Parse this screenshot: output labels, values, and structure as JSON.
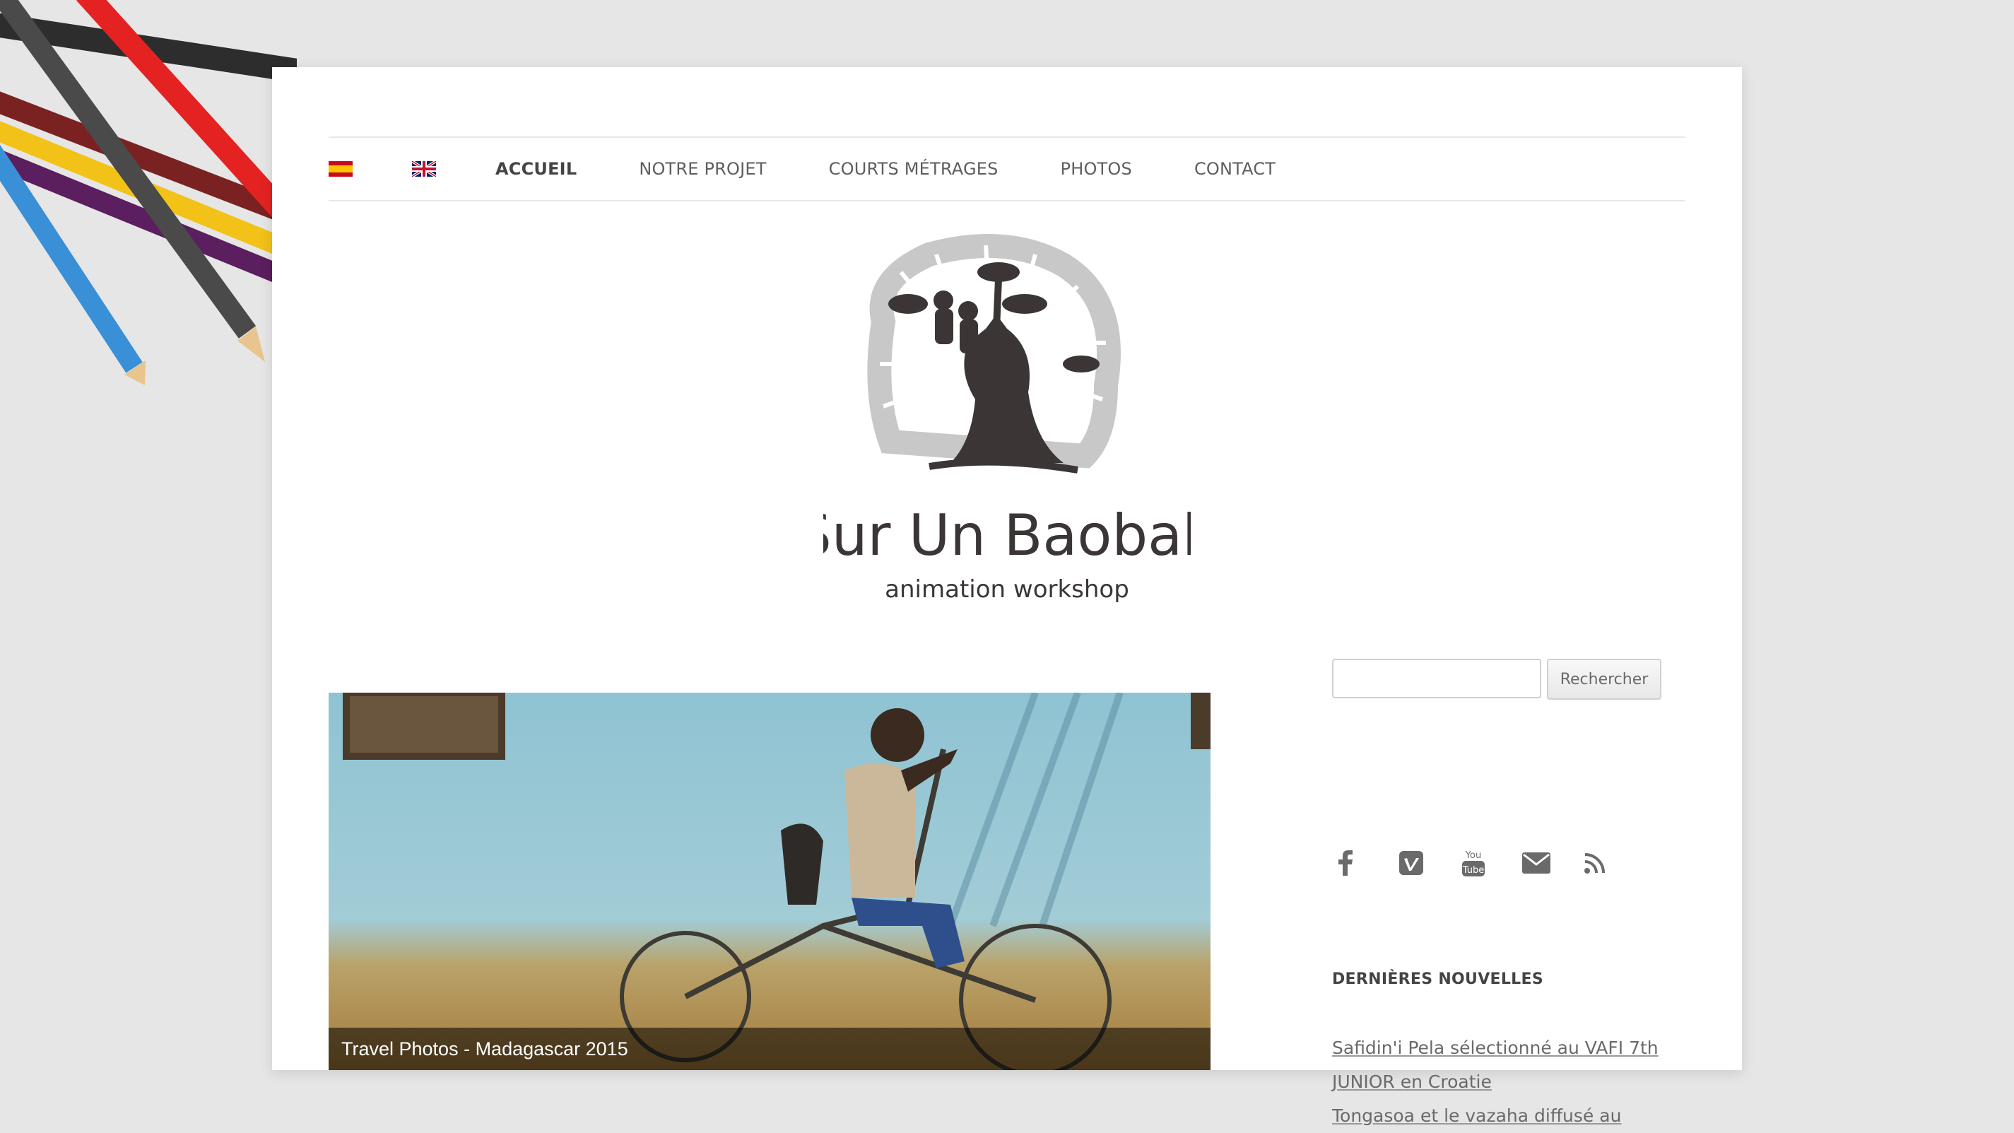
{
  "nav": {
    "flags": [
      {
        "name": "spanish-flag-icon",
        "lang": "es"
      },
      {
        "name": "english-flag-icon",
        "lang": "en"
      }
    ],
    "items": [
      {
        "label": "ACCUEIL",
        "active": true
      },
      {
        "label": "NOTRE PROJET",
        "active": false
      },
      {
        "label": "COURTS MÉTRAGES",
        "active": false
      },
      {
        "label": "PHOTOS",
        "active": false
      },
      {
        "label": "CONTACT",
        "active": false
      }
    ]
  },
  "logo": {
    "title": "Sur Un Baobab",
    "subtitle": "animation workshop"
  },
  "featured": {
    "caption": "Travel Photos - Madagascar 2015"
  },
  "search": {
    "value": "",
    "placeholder": "",
    "button_label": "Rechercher"
  },
  "social": [
    "facebook-icon",
    "vimeo-icon",
    "youtube-icon",
    "email-icon",
    "rss-icon"
  ],
  "sidebar": {
    "news_title": "DERNIÈRES NOUVELLES",
    "news": [
      {
        "text": "Safidin'i Pela sélectionné au VAFI 7th JUNIOR en Croatie"
      },
      {
        "text": "Tongasoa et le vazaha diffusé au"
      }
    ]
  },
  "colors": {
    "background": "#e6e6e6",
    "page": "#ffffff",
    "nav_text": "#5e5e5e",
    "link": "#6a6a6a"
  }
}
